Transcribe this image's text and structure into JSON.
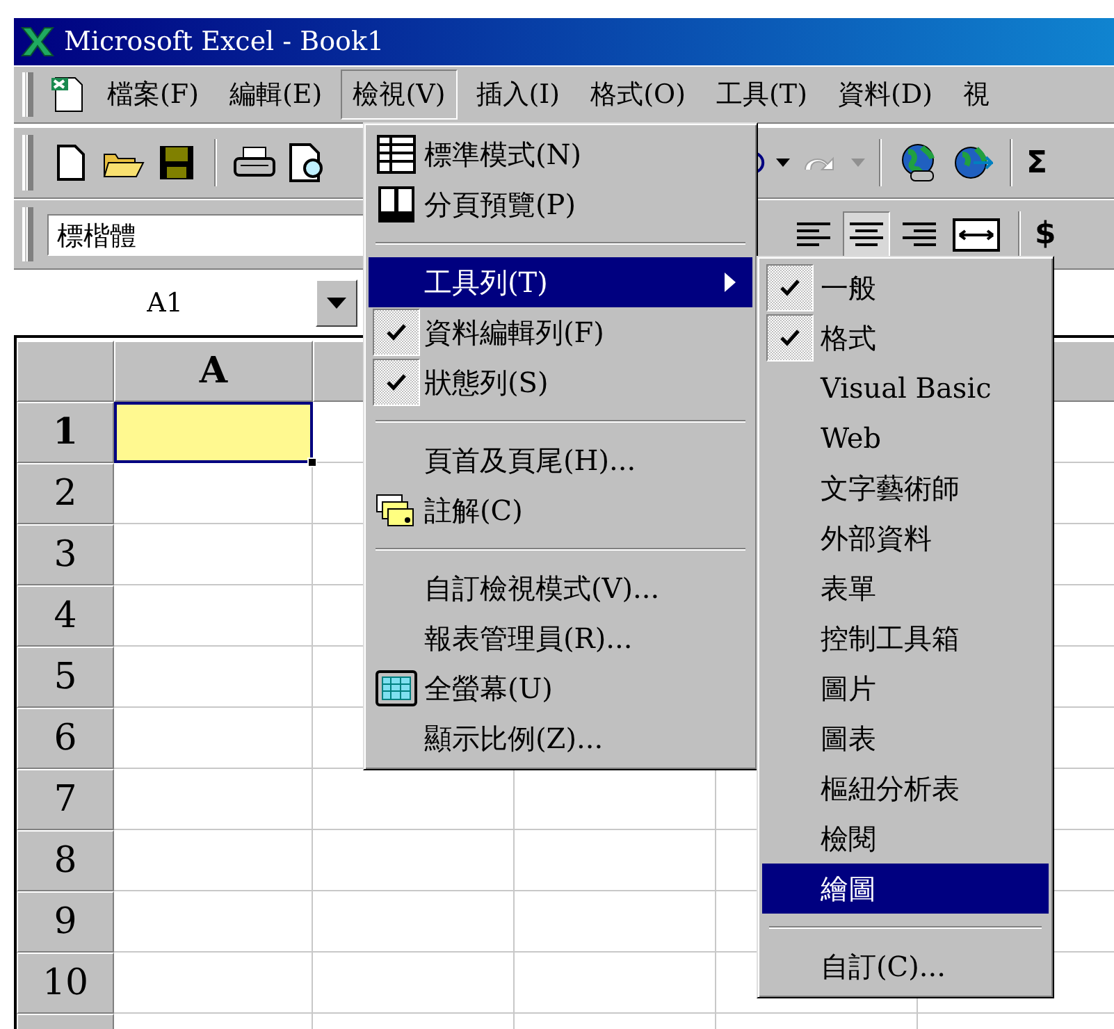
{
  "window": {
    "title": "Microsoft Excel - Book1"
  },
  "menu_bar": [
    {
      "label": "檔案(F)",
      "selected": false
    },
    {
      "label": "編輯(E)",
      "selected": false
    },
    {
      "label": "檢視(V)",
      "selected": true
    },
    {
      "label": "插入(I)",
      "selected": false
    },
    {
      "label": "格式(O)",
      "selected": false
    },
    {
      "label": "工具(T)",
      "selected": false
    },
    {
      "label": "資料(D)",
      "selected": false
    },
    {
      "label": "視",
      "selected": false
    }
  ],
  "standard_toolbar": {
    "sum_label": "Σ"
  },
  "formatting_toolbar": {
    "font": "標楷體",
    "alignment": [
      {
        "kind": "left",
        "selected": false
      },
      {
        "kind": "center",
        "selected": true
      },
      {
        "kind": "right",
        "selected": false
      }
    ],
    "currency": "$"
  },
  "name_box": {
    "value": "A1"
  },
  "sheet": {
    "columns": [
      {
        "label": "A",
        "selected": true
      }
    ],
    "rows": [
      {
        "label": "1",
        "selected": true
      },
      {
        "label": "2",
        "selected": false
      },
      {
        "label": "3",
        "selected": false
      },
      {
        "label": "4",
        "selected": false
      },
      {
        "label": "5",
        "selected": false
      },
      {
        "label": "6",
        "selected": false
      },
      {
        "label": "7",
        "selected": false
      },
      {
        "label": "8",
        "selected": false
      },
      {
        "label": "9",
        "selected": false
      },
      {
        "label": "10",
        "selected": false
      }
    ]
  },
  "view_menu": {
    "items": [
      {
        "kind": "item",
        "label": "標準模式(N)",
        "checked": false,
        "selected": false,
        "submenu": false
      },
      {
        "kind": "item",
        "label": "分頁預覽(P)",
        "checked": false,
        "selected": false,
        "submenu": false
      },
      {
        "kind": "separator"
      },
      {
        "kind": "item",
        "label": "工具列(T)",
        "checked": false,
        "selected": true,
        "submenu": true
      },
      {
        "kind": "item",
        "label": "資料編輯列(F)",
        "checked": true,
        "selected": false,
        "submenu": false
      },
      {
        "kind": "item",
        "label": "狀態列(S)",
        "checked": true,
        "selected": false,
        "submenu": false
      },
      {
        "kind": "separator"
      },
      {
        "kind": "item",
        "label": "頁首及頁尾(H)...",
        "checked": false,
        "selected": false,
        "submenu": false
      },
      {
        "kind": "item",
        "label": "註解(C)",
        "checked": false,
        "selected": false,
        "submenu": false
      },
      {
        "kind": "separator"
      },
      {
        "kind": "item",
        "label": "自訂檢視模式(V)...",
        "checked": false,
        "selected": false,
        "submenu": false
      },
      {
        "kind": "item",
        "label": "報表管理員(R)...",
        "checked": false,
        "selected": false,
        "submenu": false
      },
      {
        "kind": "item",
        "label": "全螢幕(U)",
        "checked": false,
        "selected": false,
        "submenu": false
      },
      {
        "kind": "item",
        "label": "顯示比例(Z)...",
        "checked": false,
        "selected": false,
        "submenu": false
      }
    ]
  },
  "toolbars_submenu": {
    "items": [
      {
        "kind": "item",
        "label": "一般",
        "checked": true,
        "selected": false
      },
      {
        "kind": "item",
        "label": "格式",
        "checked": true,
        "selected": false
      },
      {
        "kind": "item",
        "label": "Visual Basic",
        "checked": false,
        "selected": false
      },
      {
        "kind": "item",
        "label": "Web",
        "checked": false,
        "selected": false
      },
      {
        "kind": "item",
        "label": "文字藝術師",
        "checked": false,
        "selected": false
      },
      {
        "kind": "item",
        "label": "外部資料",
        "checked": false,
        "selected": false
      },
      {
        "kind": "item",
        "label": "表單",
        "checked": false,
        "selected": false
      },
      {
        "kind": "item",
        "label": "控制工具箱",
        "checked": false,
        "selected": false
      },
      {
        "kind": "item",
        "label": "圖片",
        "checked": false,
        "selected": false
      },
      {
        "kind": "item",
        "label": "圖表",
        "checked": false,
        "selected": false
      },
      {
        "kind": "item",
        "label": "樞紐分析表",
        "checked": false,
        "selected": false
      },
      {
        "kind": "item",
        "label": "檢閱",
        "checked": false,
        "selected": false
      },
      {
        "kind": "item",
        "label": "繪圖",
        "checked": false,
        "selected": true
      },
      {
        "kind": "separator"
      },
      {
        "kind": "item",
        "label": "自訂(C)...",
        "checked": false,
        "selected": false
      }
    ]
  }
}
